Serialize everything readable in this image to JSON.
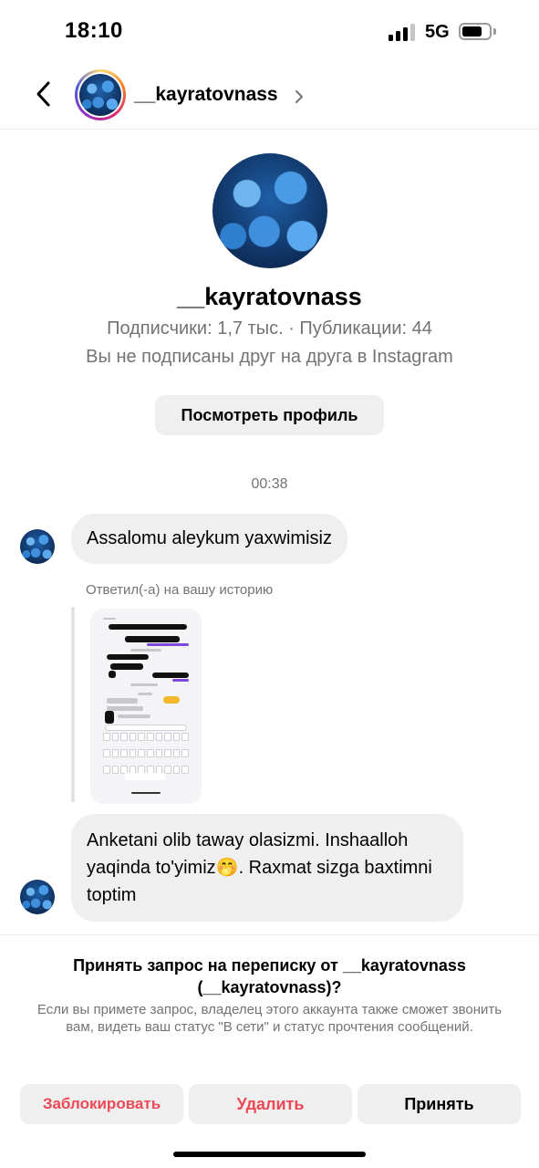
{
  "status_bar": {
    "time": "18:10",
    "network": "5G",
    "signal_bars_active": 3,
    "signal_bars_total": 4
  },
  "header": {
    "username": "__kayratovnass",
    "back_icon": "chevron-left-icon",
    "chevron_icon": "chevron-right-icon"
  },
  "profile": {
    "name": "__kayratovnass",
    "stats": "Подписчики: 1,7 тыс. · Публикации: 44",
    "note": "Вы не подписаны друг на друга в Instagram",
    "view_profile_label": "Посмотреть профиль"
  },
  "conversation": {
    "timestamp": "00:38",
    "message_1": "Assalomu aleykum yaxwimisiz",
    "reply_label": "Ответил(-а) на вашу историю",
    "message_2": "Anketani olib taway olasizmi. Inshaalloh yaqinda to'yimiz🤭. Raxmat sizga baxtimni toptim"
  },
  "request": {
    "title": "Принять запрос на переписку от __kayratovnass (__kayratovnass)?",
    "description": "Если вы примете запрос, владелец этого аккаунта также сможет звонить вам, видеть ваш статус \"В сети\" и статус прочтения сообщений.",
    "block_label": "Заблокировать",
    "delete_label": "Удалить",
    "accept_label": "Принять"
  },
  "colors": {
    "danger": "#ed4956",
    "secondary_text": "#737373",
    "bubble_bg": "#efefef"
  }
}
